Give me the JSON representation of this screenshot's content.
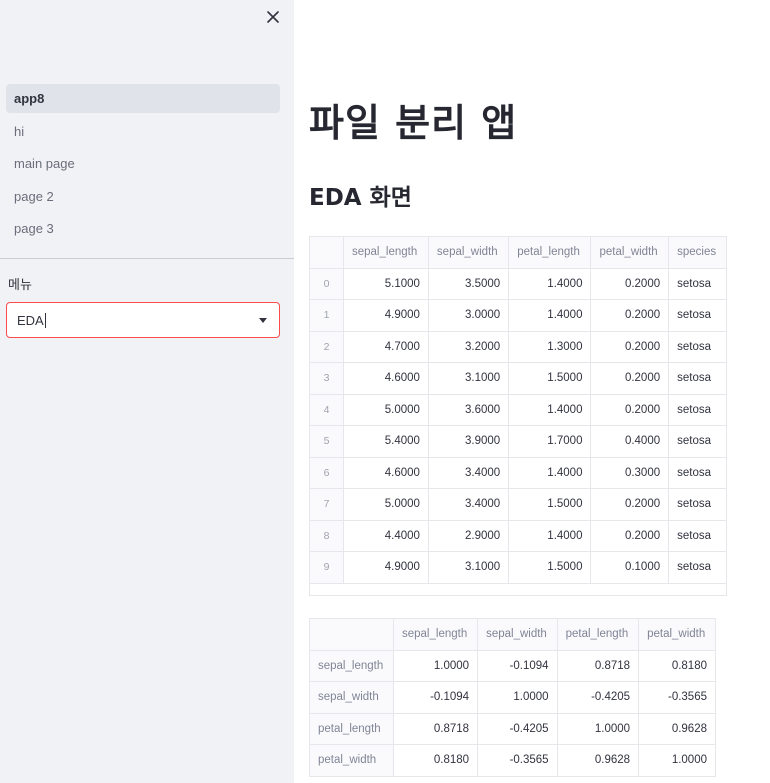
{
  "sidebar": {
    "close_icon": "close-icon",
    "nav_items": [
      {
        "label": "app8",
        "active": true
      },
      {
        "label": "hi",
        "active": false
      },
      {
        "label": "main page",
        "active": false
      },
      {
        "label": "page 2",
        "active": false
      },
      {
        "label": "page 3",
        "active": false
      }
    ],
    "menu_label": "메뉴",
    "select_value": "EDA",
    "select_icon": "chevron-down-icon"
  },
  "main": {
    "title": "파일 분리 앱",
    "subtitle": "EDA 화면",
    "data_table": {
      "columns": [
        "sepal_length",
        "sepal_width",
        "petal_length",
        "petal_width",
        "species"
      ],
      "rows": [
        [
          "0",
          "5.1000",
          "3.5000",
          "1.4000",
          "0.2000",
          "setosa"
        ],
        [
          "1",
          "4.9000",
          "3.0000",
          "1.4000",
          "0.2000",
          "setosa"
        ],
        [
          "2",
          "4.7000",
          "3.2000",
          "1.3000",
          "0.2000",
          "setosa"
        ],
        [
          "3",
          "4.6000",
          "3.1000",
          "1.5000",
          "0.2000",
          "setosa"
        ],
        [
          "4",
          "5.0000",
          "3.6000",
          "1.4000",
          "0.2000",
          "setosa"
        ],
        [
          "5",
          "5.4000",
          "3.9000",
          "1.7000",
          "0.4000",
          "setosa"
        ],
        [
          "6",
          "4.6000",
          "3.4000",
          "1.4000",
          "0.3000",
          "setosa"
        ],
        [
          "7",
          "5.0000",
          "3.4000",
          "1.5000",
          "0.2000",
          "setosa"
        ],
        [
          "8",
          "4.4000",
          "2.9000",
          "1.4000",
          "0.2000",
          "setosa"
        ],
        [
          "9",
          "4.9000",
          "3.1000",
          "1.5000",
          "0.1000",
          "setosa"
        ]
      ]
    },
    "corr_table": {
      "columns": [
        "sepal_length",
        "sepal_width",
        "petal_length",
        "petal_width"
      ],
      "rows": [
        [
          "sepal_length",
          "1.0000",
          "-0.1094",
          "0.8718",
          "0.8180"
        ],
        [
          "sepal_width",
          "-0.1094",
          "1.0000",
          "-0.4205",
          "-0.3565"
        ],
        [
          "petal_length",
          "0.8718",
          "-0.4205",
          "1.0000",
          "0.9628"
        ],
        [
          "petal_width",
          "0.8180",
          "-0.3565",
          "0.9628",
          "1.0000"
        ]
      ]
    }
  }
}
